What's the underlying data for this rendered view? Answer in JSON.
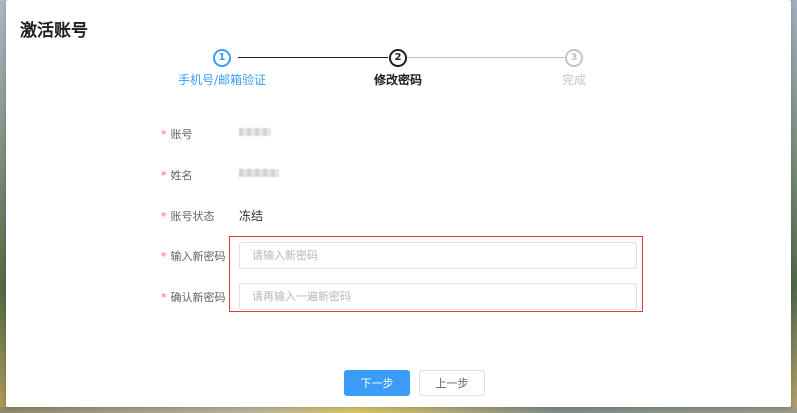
{
  "dialog": {
    "title": "激活账号"
  },
  "steps": [
    {
      "number": "1",
      "label": "手机号/邮箱验证",
      "state": "done"
    },
    {
      "number": "2",
      "label": "修改密码",
      "state": "active"
    },
    {
      "number": "3",
      "label": "完成",
      "state": "pending"
    }
  ],
  "colors": {
    "primary": "#3a9cf6",
    "active": "#1f1f1f",
    "pending": "#c0c4cc",
    "required": "#f56c6c",
    "highlight": "#e03a3a"
  },
  "form": {
    "required_mark": "*",
    "account": {
      "label": "账号"
    },
    "name": {
      "label": "姓名"
    },
    "status": {
      "label": "账号状态",
      "value": "冻结"
    },
    "new_password": {
      "label": "输入新密码",
      "placeholder": "请输入新密码"
    },
    "confirm_password": {
      "label": "确认新密码",
      "placeholder": "请再输入一遍新密码"
    }
  },
  "buttons": {
    "next": "下一步",
    "prev": "上一步"
  }
}
